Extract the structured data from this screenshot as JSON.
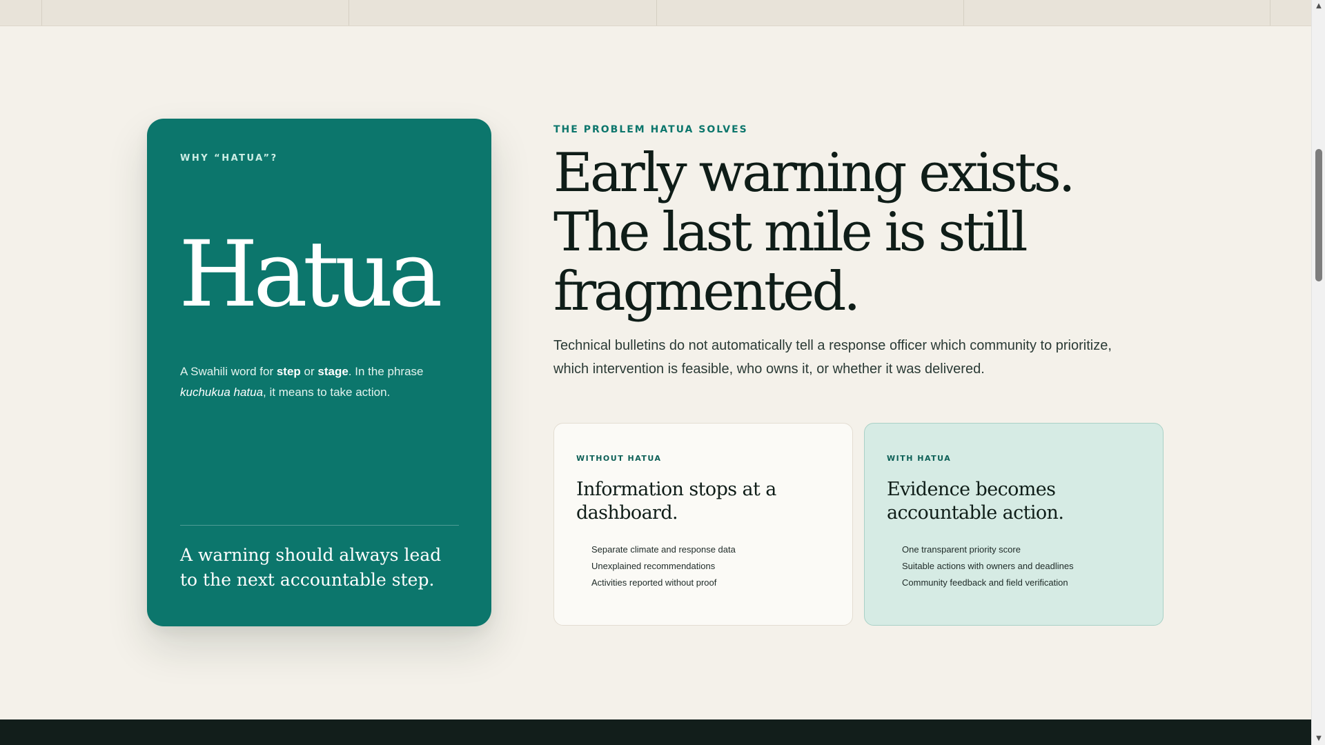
{
  "why_card": {
    "eyebrow": "WHY “HATUA”?",
    "word": "Hatua",
    "definition": {
      "prefix": "A Swahili word for ",
      "term1": "step",
      "connector": " or ",
      "term2": "stage",
      "middle": ". In the phrase ",
      "phrase": "kuchukua hatua",
      "suffix": ", it means to take action."
    },
    "quote": "A warning should always lead to the next accountable step."
  },
  "problem": {
    "eyebrow": "THE PROBLEM HATUA SOLVES",
    "headline_lines": [
      "Early warning exists.",
      "The last mile is still",
      "fragmented."
    ],
    "lede": "Technical bulletins do not automatically tell a response officer which community to prioritize, which intervention is feasible, who owns it, or whether it was delivered."
  },
  "comparison": {
    "without": {
      "eyebrow": "WITHOUT HATUA",
      "title": "Information stops at a dashboard.",
      "items": [
        "Separate climate and response data",
        "Unexplained recommendations",
        "Activities reported without proof"
      ]
    },
    "with": {
      "eyebrow": "WITH HATUA",
      "title": "Evidence becomes accountable action.",
      "items": [
        "One transparent priority score",
        "Suitable actions with owners and deadlines",
        "Community feedback and field verification"
      ]
    }
  },
  "colors": {
    "brand_green": "#0c766c",
    "page_background": "#f4f1ea",
    "with_card_background": "#d6ebe4",
    "dark_band": "#121e1b"
  },
  "scrollbar": {
    "up_icon": "triangle-up-icon",
    "down_icon": "triangle-down-icon"
  }
}
